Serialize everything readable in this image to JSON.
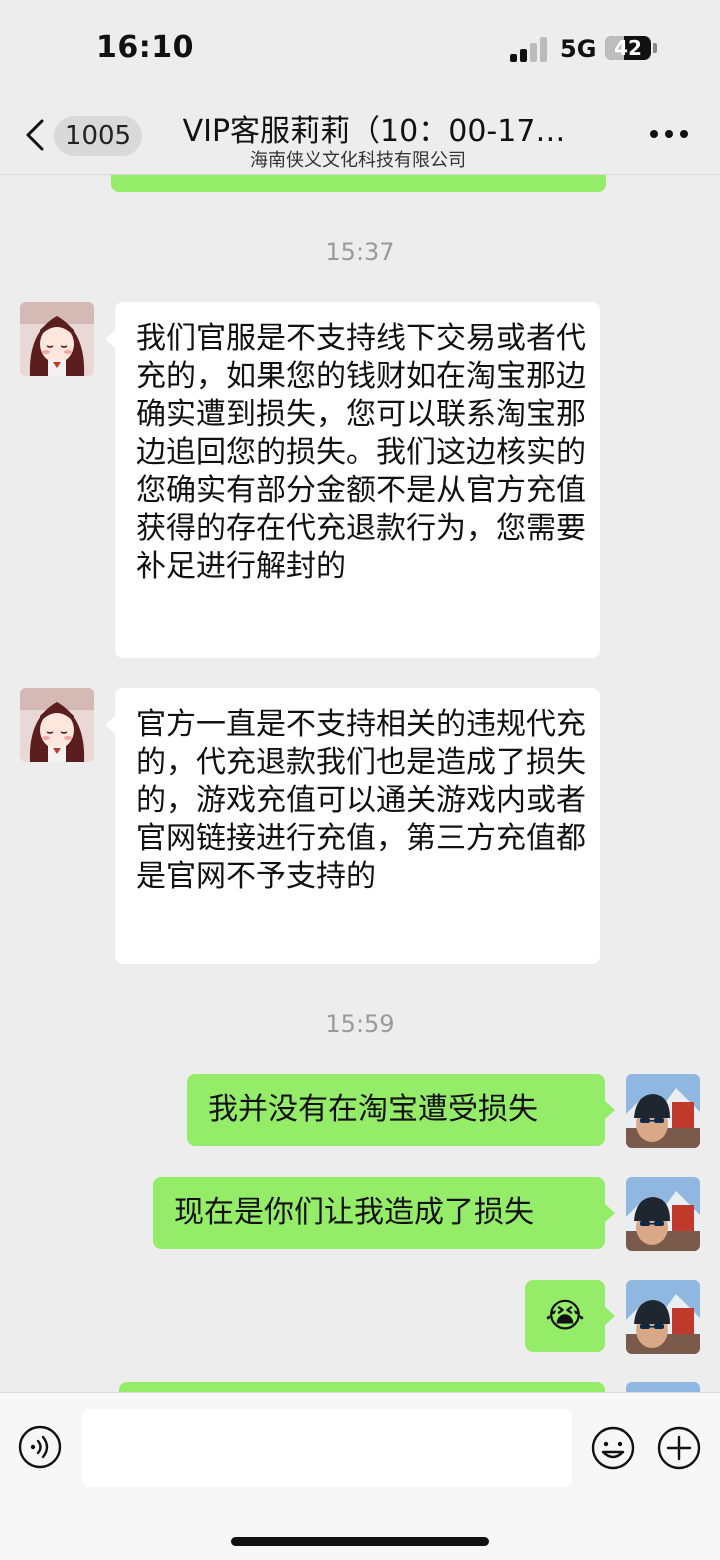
{
  "status_bar": {
    "time": "16:10",
    "network": "5G",
    "battery_level": "42",
    "battery_fraction": 0.42
  },
  "nav": {
    "unread_count": "1005",
    "title": "VIP客服莉莉（10：00-17…",
    "subtitle": "海南侠义文化科技有限公司",
    "more_icon": "more-dots-icon",
    "back_icon": "chevron-left-icon"
  },
  "messages": {
    "timestamp_1": "15:37",
    "msg_1_text": "我们官服是不支持线下交易或者代充的，如果您的钱财如在淘宝那边确实遭到损失，您可以联系淘宝那边追回您的损失。我们这边核实的您确实有部分金额不是从官方充值获得的存在代充退款行为，您需要补足进行解封的",
    "msg_2_text": "官方一直是不支持相关的违规代充的，代充退款我们也是造成了损失的，游戏充值可以通关游戏内或者官网链接进行充值，第三方充值都是官网不予支持的",
    "timestamp_2": "15:59",
    "msg_3_text": "我并没有在淘宝遭受损失",
    "msg_4_text": "现在是你们让我造成了损失",
    "msg_5_emoji": "😭"
  },
  "input_bar": {
    "placeholder": "",
    "voice_icon": "voice-icon",
    "emoji_icon": "emoji-icon",
    "plus_icon": "plus-icon"
  },
  "colors": {
    "chat_background": "#ededed",
    "incoming_bubble": "#ffffff",
    "outgoing_bubble": "#95ec69",
    "timestamp_text": "#9a9a9a"
  }
}
